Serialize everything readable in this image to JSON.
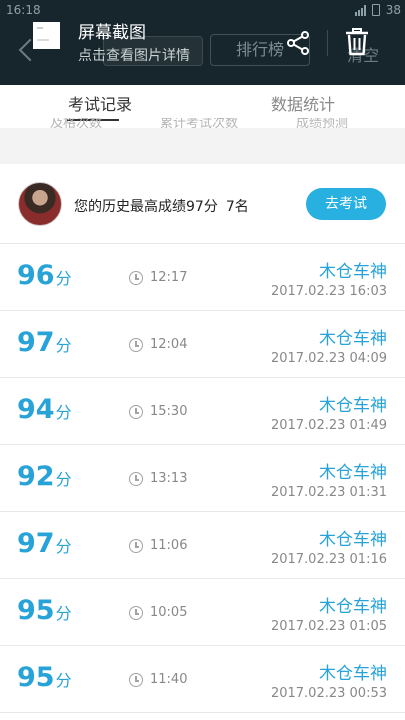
{
  "status_bar": {
    "time": "16:18",
    "battery": "38"
  },
  "notification": {
    "title": "屏幕截图",
    "subtitle": "点击查看图片详情",
    "share_icon": "share-icon",
    "delete_icon": "trash-icon"
  },
  "header": {
    "ranking_label": "排行榜",
    "clear_label": "清空"
  },
  "tabs": [
    {
      "label": "考试记录",
      "active": true
    },
    {
      "label": "数据统计",
      "active": false
    }
  ],
  "hidden_labels": [
    "及格次数",
    "累计考试次数",
    "成绩预测"
  ],
  "best": {
    "text": "您的历史最高成绩97分",
    "rank": "7名",
    "button": "去考试"
  },
  "records": [
    {
      "score": "96",
      "unit": "分",
      "duration": "12:17",
      "name": "木仓车神",
      "date": "2017.02.23  16:03"
    },
    {
      "score": "97",
      "unit": "分",
      "duration": "12:04",
      "name": "木仓车神",
      "date": "2017.02.23  04:09"
    },
    {
      "score": "94",
      "unit": "分",
      "duration": "15:30",
      "name": "木仓车神",
      "date": "2017.02.23  01:49"
    },
    {
      "score": "92",
      "unit": "分",
      "duration": "13:13",
      "name": "木仓车神",
      "date": "2017.02.23  01:31"
    },
    {
      "score": "97",
      "unit": "分",
      "duration": "11:06",
      "name": "木仓车神",
      "date": "2017.02.23  01:16"
    },
    {
      "score": "95",
      "unit": "分",
      "duration": "10:05",
      "name": "木仓车神",
      "date": "2017.02.23  01:05"
    },
    {
      "score": "95",
      "unit": "分",
      "duration": "11:40",
      "name": "木仓车神",
      "date": "2017.02.23  00:53"
    }
  ],
  "colors": {
    "accent": "#27b0e0",
    "score": "#27a3d8",
    "overlay": "#17262c"
  }
}
